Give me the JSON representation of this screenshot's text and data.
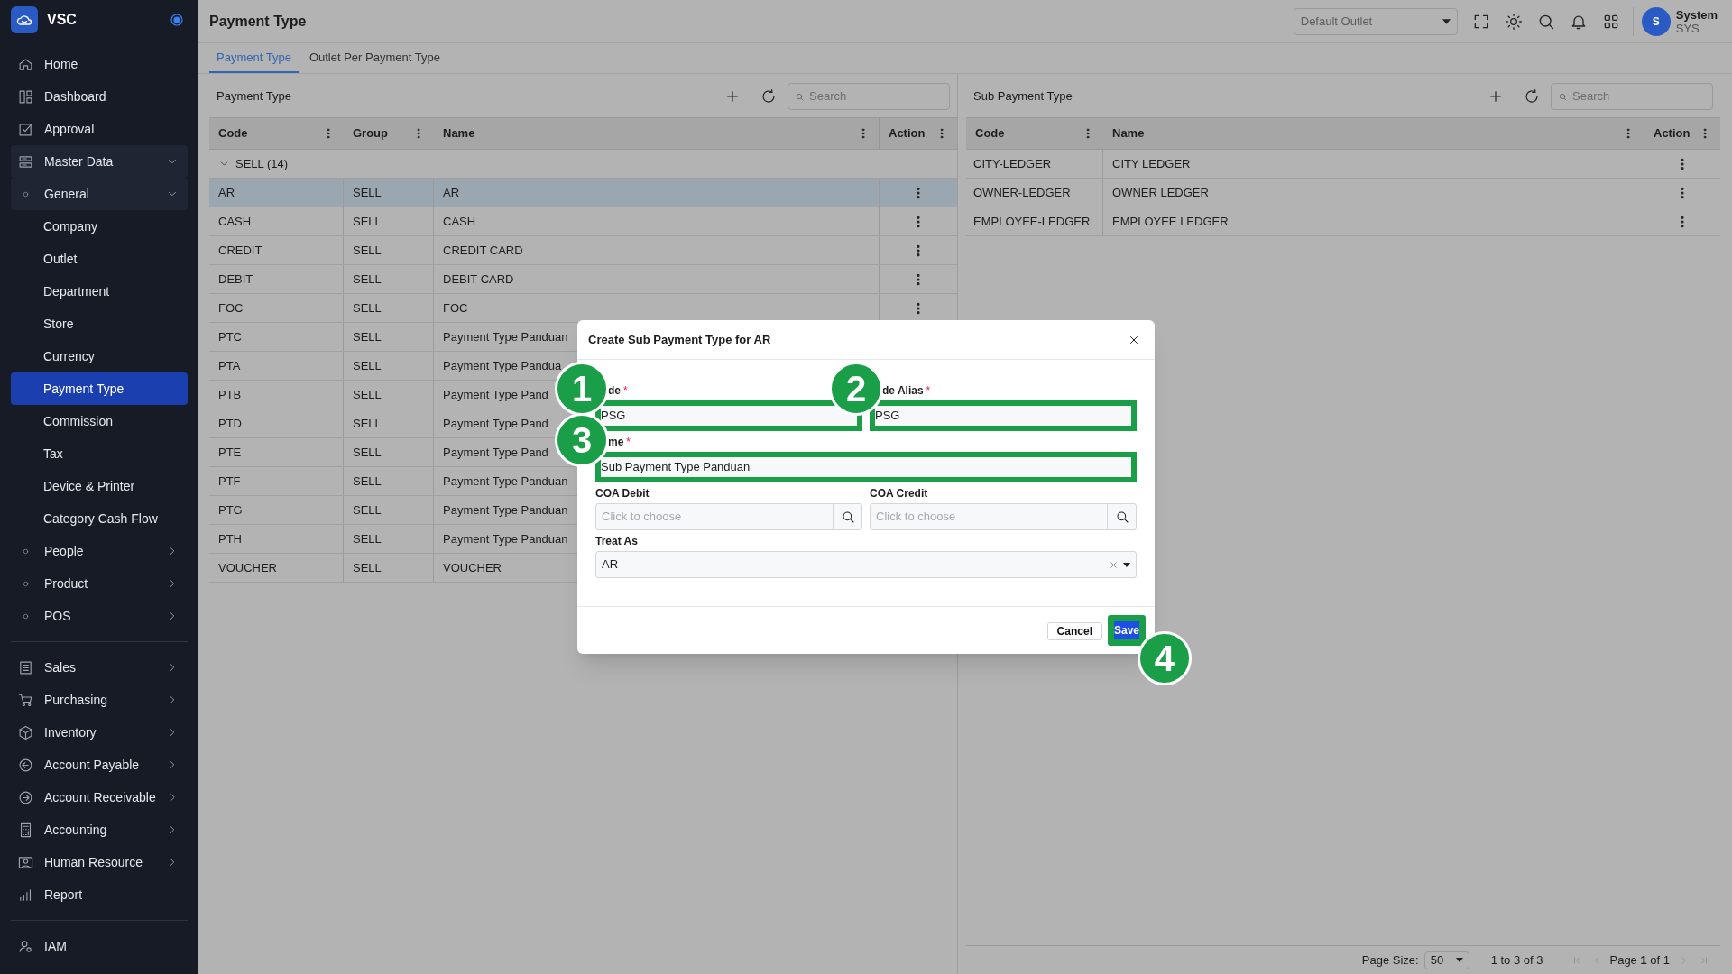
{
  "app": {
    "name": "VSC"
  },
  "sidebar": {
    "sections": [
      {
        "items": [
          {
            "label": "Home"
          },
          {
            "label": "Dashboard"
          },
          {
            "label": "Approval"
          },
          {
            "label": "Master Data",
            "expanded": true,
            "children": [
              {
                "label": "General",
                "expanded": true,
                "children": [
                  {
                    "label": "Company",
                    "selected": false
                  },
                  {
                    "label": "Outlet",
                    "selected": false
                  },
                  {
                    "label": "Department",
                    "selected": false
                  },
                  {
                    "label": "Store",
                    "selected": false
                  },
                  {
                    "label": "Currency",
                    "selected": false
                  },
                  {
                    "label": "Payment Type",
                    "selected": true
                  },
                  {
                    "label": "Commission",
                    "selected": false
                  },
                  {
                    "label": "Tax",
                    "selected": false
                  },
                  {
                    "label": "Device & Printer",
                    "selected": false
                  },
                  {
                    "label": "Category Cash Flow",
                    "selected": false
                  }
                ]
              },
              {
                "label": "People",
                "expanded": false
              },
              {
                "label": "Product",
                "expanded": false
              },
              {
                "label": "POS",
                "expanded": false
              }
            ]
          }
        ]
      },
      {
        "items": [
          {
            "label": "Sales",
            "expanded": false
          },
          {
            "label": "Purchasing",
            "expanded": false
          },
          {
            "label": "Inventory",
            "expanded": false
          },
          {
            "label": "Account Payable",
            "expanded": false
          },
          {
            "label": "Account Receivable",
            "expanded": false
          },
          {
            "label": "Accounting",
            "expanded": false
          },
          {
            "label": "Human Resource",
            "expanded": false
          },
          {
            "label": "Report"
          }
        ]
      },
      {
        "items": [
          {
            "label": "IAM"
          }
        ]
      }
    ]
  },
  "header": {
    "title": "Payment Type",
    "outlet_select": {
      "placeholder": "Default Outlet"
    },
    "user": {
      "initial": "S",
      "name": "System",
      "code": "SYS"
    }
  },
  "tabs": [
    {
      "label": "Payment Type",
      "selected": true
    },
    {
      "label": "Outlet Per Payment Type",
      "selected": false
    }
  ],
  "payment_type_panel": {
    "title": "Payment Type",
    "search": {
      "placeholder": "Search"
    },
    "columns": [
      "Code",
      "Group",
      "Name",
      "Action"
    ],
    "groups": [
      {
        "label": "SELL (14)",
        "expanded": true,
        "rows": [
          {
            "code": "AR",
            "group": "SELL",
            "name": "AR",
            "selected": true
          },
          {
            "code": "CASH",
            "group": "SELL",
            "name": "CASH",
            "selected": false
          },
          {
            "code": "CREDIT",
            "group": "SELL",
            "name": "CREDIT CARD",
            "selected": false
          },
          {
            "code": "DEBIT",
            "group": "SELL",
            "name": "DEBIT CARD",
            "selected": false
          },
          {
            "code": "FOC",
            "group": "SELL",
            "name": "FOC",
            "selected": false
          },
          {
            "code": "PTC",
            "group": "SELL",
            "name": "Payment Type Panduan",
            "selected": false
          },
          {
            "code": "PTA",
            "group": "SELL",
            "name": "Payment Type Pandua",
            "selected": false
          },
          {
            "code": "PTB",
            "group": "SELL",
            "name": "Payment Type Pand",
            "selected": false
          },
          {
            "code": "PTD",
            "group": "SELL",
            "name": "Payment Type Pand",
            "selected": false
          },
          {
            "code": "PTE",
            "group": "SELL",
            "name": "Payment Type Pand",
            "selected": false
          },
          {
            "code": "PTF",
            "group": "SELL",
            "name": "Payment Type Panduan",
            "selected": false
          },
          {
            "code": "PTG",
            "group": "SELL",
            "name": "Payment Type Panduan",
            "selected": false
          },
          {
            "code": "PTH",
            "group": "SELL",
            "name": "Payment Type Panduan",
            "selected": false
          },
          {
            "code": "VOUCHER",
            "group": "SELL",
            "name": "VOUCHER",
            "selected": false
          }
        ]
      }
    ]
  },
  "sub_payment_type_panel": {
    "title": "Sub Payment Type",
    "search": {
      "placeholder": "Search"
    },
    "columns": [
      "Code",
      "Name",
      "Action"
    ],
    "rows": [
      {
        "code": "CITY-LEDGER",
        "name": "CITY LEDGER"
      },
      {
        "code": "OWNER-LEDGER",
        "name": "OWNER LEDGER"
      },
      {
        "code": "EMPLOYEE-LEDGER",
        "name": "EMPLOYEE LEDGER"
      }
    ],
    "pagination": {
      "page_size_label": "Page Size:",
      "page_size": "50",
      "range": "1 to 3 of 3",
      "page": "Page **1** of 1"
    }
  },
  "dialog": {
    "title": "Create Sub Payment Type for AR",
    "rows": [
      [
        {
          "kind": "text",
          "label": "de",
          "required_mark": "*",
          "value": "PSG",
          "highlighted": true,
          "callout": "1"
        },
        {
          "kind": "text",
          "label": "de Alias",
          "required_mark": "*",
          "value": "PSG",
          "highlighted": true,
          "callout": "2"
        }
      ],
      [
        {
          "kind": "text",
          "label": "me",
          "required_mark": "*",
          "value": "Sub Payment Type Panduan",
          "highlighted": true,
          "callout": "3"
        }
      ],
      [
        {
          "kind": "lookup",
          "label": "COA Debit",
          "placeholder": "Click to choose",
          "highlighted": false
        },
        {
          "kind": "lookup",
          "label": "COA Credit",
          "placeholder": "Click to choose",
          "highlighted": false
        }
      ],
      [
        {
          "kind": "select",
          "label": "Treat As",
          "value": "AR",
          "highlighted": false
        }
      ]
    ],
    "buttons": [
      {
        "kind": "secondary",
        "label": "Cancel",
        "highlighted": false
      },
      {
        "kind": "primary",
        "label": "Save",
        "highlighted": true,
        "callout": "4"
      }
    ]
  }
}
